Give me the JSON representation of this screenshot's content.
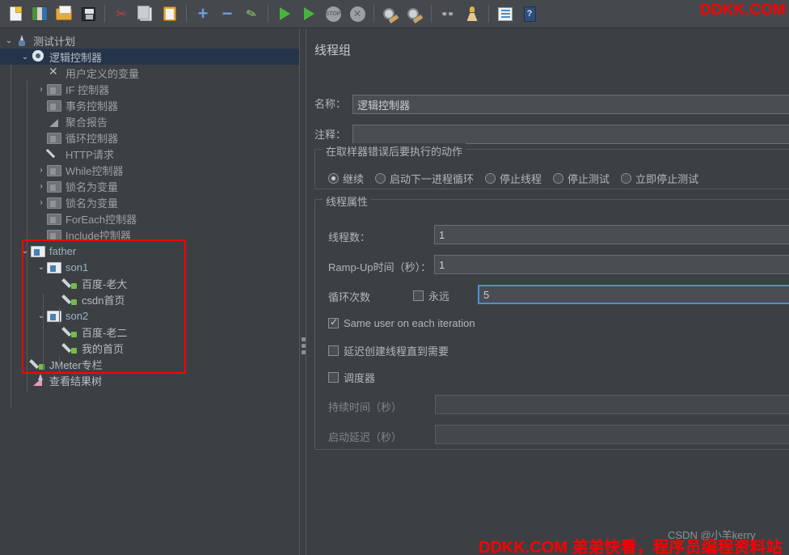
{
  "window": {
    "watermark_top_right": "DDKK.COM",
    "watermark_bottom": "DDKK.COM 弟弟快看，程序员编程资料站",
    "watermark_csdn": "CSDN @小羊kerry"
  },
  "toolbar": {
    "items": [
      {
        "icon": "new-file-icon",
        "label": "新建"
      },
      {
        "icon": "templates-icon",
        "label": "模板"
      },
      {
        "icon": "open-folder-icon",
        "label": "打开"
      },
      {
        "icon": "save-icon",
        "label": "保存"
      },
      {
        "icon": "cut-icon",
        "label": "剪切"
      },
      {
        "icon": "copy-icon",
        "label": "复制"
      },
      {
        "icon": "paste-icon",
        "label": "粘贴"
      },
      {
        "icon": "expand-all-icon",
        "label": "展开全部"
      },
      {
        "icon": "collapse-all-icon",
        "label": "收起全部"
      },
      {
        "icon": "toggle-icon",
        "label": "启用/禁用"
      },
      {
        "icon": "start-icon",
        "label": "启动"
      },
      {
        "icon": "start-no-pauses-icon",
        "label": "无间隔启动"
      },
      {
        "icon": "stop-icon",
        "label": "停止"
      },
      {
        "icon": "shutdown-icon",
        "label": "关闭"
      },
      {
        "icon": "clear-icon",
        "label": "清除"
      },
      {
        "icon": "clear-all-icon",
        "label": "清除全部"
      },
      {
        "icon": "search-binoculars-icon",
        "label": "查找"
      },
      {
        "icon": "reset-search-broom-icon",
        "label": "重置查找"
      },
      {
        "icon": "log-viewer-icon",
        "label": "日志查看"
      },
      {
        "icon": "help-icon",
        "label": "帮助"
      }
    ]
  },
  "tree": {
    "nodes": [
      {
        "label": "测试计划",
        "depth": 0,
        "arrow": "down",
        "icon": "test-plan-icon",
        "state": "bright",
        "selected": false
      },
      {
        "label": "逻辑控制器",
        "depth": 1,
        "arrow": "down",
        "icon": "gear-icon",
        "state": "bright",
        "selected": true
      },
      {
        "label": "用户定义的变量",
        "depth": 2,
        "arrow": "none",
        "icon": "tools-icon",
        "state": "dim",
        "selected": false
      },
      {
        "label": "IF 控制器",
        "depth": 2,
        "arrow": "right",
        "icon": "controller-icon",
        "state": "dim",
        "selected": false
      },
      {
        "label": "事务控制器",
        "depth": 2,
        "arrow": "none",
        "icon": "controller-icon",
        "state": "dim",
        "selected": false
      },
      {
        "label": "聚合报告",
        "depth": 2,
        "arrow": "none",
        "icon": "chart-icon",
        "state": "dim",
        "selected": false
      },
      {
        "label": "循环控制器",
        "depth": 2,
        "arrow": "none",
        "icon": "controller-icon",
        "state": "dim",
        "selected": false
      },
      {
        "label": "HTTP请求",
        "depth": 2,
        "arrow": "none",
        "icon": "pen-icon",
        "state": "dim",
        "selected": false
      },
      {
        "label": "While控制器",
        "depth": 2,
        "arrow": "right",
        "icon": "controller-icon",
        "state": "dim",
        "selected": false
      },
      {
        "label": "锁名为变量",
        "depth": 2,
        "arrow": "right",
        "icon": "controller-icon",
        "state": "dim",
        "selected": false
      },
      {
        "label": "锁名为变量",
        "depth": 2,
        "arrow": "right",
        "icon": "controller-icon",
        "state": "dim",
        "selected": false
      },
      {
        "label": "ForEach控制器",
        "depth": 2,
        "arrow": "none",
        "icon": "controller-icon",
        "state": "dim",
        "selected": false
      },
      {
        "label": "Include控制器",
        "depth": 2,
        "arrow": "none",
        "icon": "controller-icon",
        "state": "dim",
        "selected": false
      },
      {
        "label": "father",
        "depth": 1,
        "arrow": "down",
        "icon": "controller-on-icon",
        "state": "blueish",
        "selected": false
      },
      {
        "label": "son1",
        "depth": 2,
        "arrow": "down",
        "icon": "controller-on-icon",
        "state": "blueish",
        "selected": false
      },
      {
        "label": "百度-老大",
        "depth": 3,
        "arrow": "none",
        "icon": "pen-green-icon",
        "state": "bright",
        "selected": false
      },
      {
        "label": "csdn首页",
        "depth": 3,
        "arrow": "none",
        "icon": "pen-green-icon",
        "state": "bright",
        "selected": false
      },
      {
        "label": "son2",
        "depth": 2,
        "arrow": "down",
        "icon": "controller-on-icon",
        "state": "blueish",
        "selected": false
      },
      {
        "label": "百度-老二",
        "depth": 3,
        "arrow": "none",
        "icon": "pen-green-icon",
        "state": "bright",
        "selected": false
      },
      {
        "label": "我的首页",
        "depth": 3,
        "arrow": "none",
        "icon": "pen-green-icon",
        "state": "bright",
        "selected": false
      },
      {
        "label": "JMeter专栏",
        "depth": 1,
        "arrow": "none",
        "icon": "pen-green-icon",
        "state": "bright",
        "selected": false
      },
      {
        "label": "查看结果树",
        "depth": 1,
        "arrow": "none",
        "icon": "chart-pink-icon",
        "state": "bright",
        "selected": false
      }
    ],
    "highlight": {
      "color": "#ff0000",
      "first_node": "father",
      "last_node": "JMeter专栏"
    }
  },
  "panel": {
    "title": "线程组",
    "name_label": "名称：",
    "name_value": "逻辑控制器",
    "comment_label": "注释：",
    "comment_value": "",
    "error_action": {
      "group_title": "在取样器错误后要执行的动作",
      "options": [
        {
          "label": "继续",
          "selected": true
        },
        {
          "label": "启动下一进程循环",
          "selected": false
        },
        {
          "label": "停止线程",
          "selected": false
        },
        {
          "label": "停止测试",
          "selected": false
        },
        {
          "label": "立即停止测试",
          "selected": false
        }
      ]
    },
    "thread_properties": {
      "group_title": "线程属性",
      "threads_label": "线程数：",
      "threads_value": "1",
      "rampup_label": "Ramp-Up时间（秒）：",
      "rampup_value": "1",
      "loop_label": "循环次数",
      "forever_label": "永远",
      "forever_checked": false,
      "loop_value": "5",
      "loop_focused": true,
      "same_user_label": "Same user on each iteration",
      "same_user_checked": true,
      "delay_create_label": "延迟创建线程直到需要",
      "delay_create_checked": false,
      "scheduler_label": "调度器",
      "scheduler_checked": false,
      "duration_label": "持续时间（秒）",
      "duration_value": "",
      "startup_delay_label": "启动延迟（秒）",
      "startup_delay_value": ""
    }
  },
  "colors": {
    "bg": "#3c4043",
    "toolbar_bg": "#45494d",
    "selection": "#26344b",
    "accent_red": "#ff0000",
    "focus_blue": "#4a90d9"
  }
}
